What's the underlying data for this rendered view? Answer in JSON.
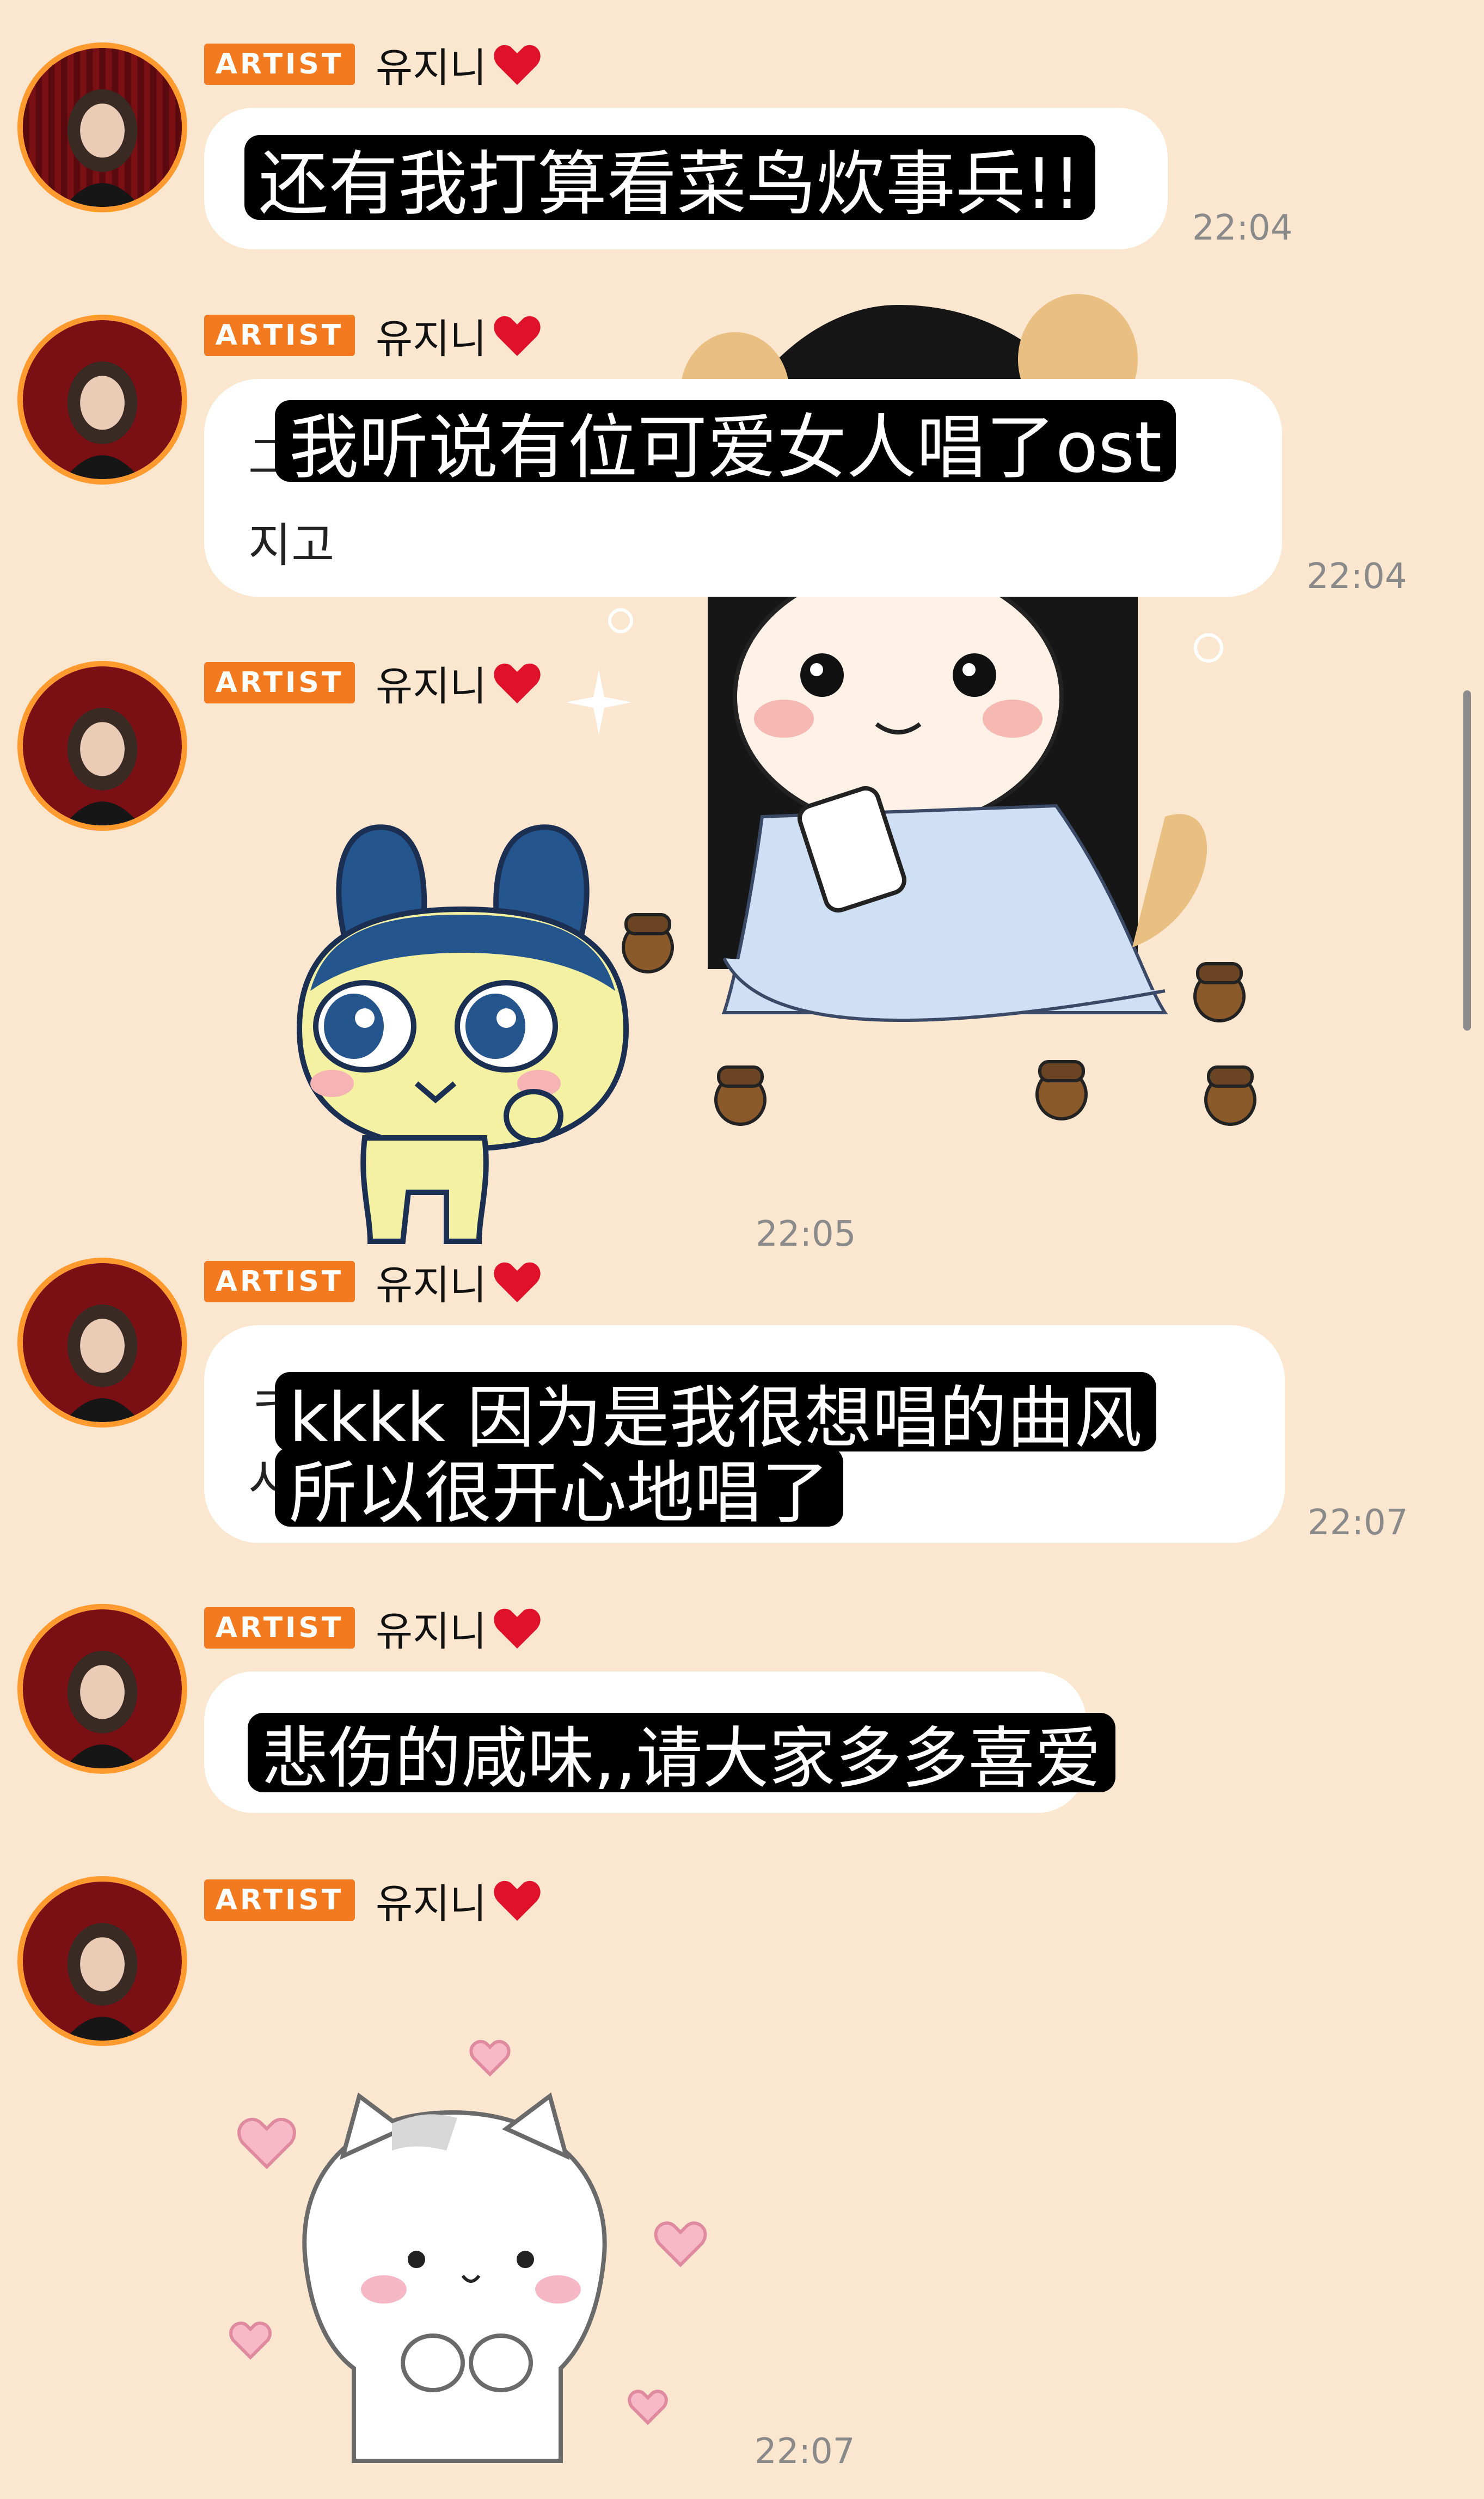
{
  "messages": [
    {
      "badge": "ARTIST",
      "sender": "유지니",
      "under_text": "",
      "caption_lines": [
        "还有我打算看菜鸟炊事兵!!"
      ],
      "time": "22:04"
    },
    {
      "badge": "ARTIST",
      "sender": "유지니",
      "under_text": "그\n지고",
      "caption_lines": [
        "我听说有位可爱女人唱了ost"
      ],
      "time": "22:04"
    },
    {
      "badge": "ARTIST",
      "sender": "유지니",
      "sticker": "tamagotchi-character",
      "time": "22:05"
    },
    {
      "badge": "ARTIST",
      "sender": "유지니",
      "under_text": "ㅋ\n시",
      "caption_lines": [
        "kkkk 因为是我很想唱的曲风",
        "所以很开心地唱了"
      ],
      "time": "22:07"
    },
    {
      "badge": "ARTIST",
      "sender": "유지니",
      "under_text": "",
      "caption_lines": [
        "悲伤的咸味,,请大家多多喜爱"
      ],
      "time": "22:07"
    },
    {
      "badge": "ARTIST",
      "sender": "유지니",
      "sticker": "white-cat-with-hearts",
      "time": "22:07"
    }
  ],
  "colors": {
    "background": "#fbe6cf",
    "badge": "#f37a1e",
    "avatar_ring": "#ff9a2f",
    "bubble": "#ffffff",
    "caption_bg": "#000000",
    "time": "#8a8a8a"
  },
  "icons": [
    "heart-icon",
    "avatar-photo",
    "scrollbar"
  ]
}
